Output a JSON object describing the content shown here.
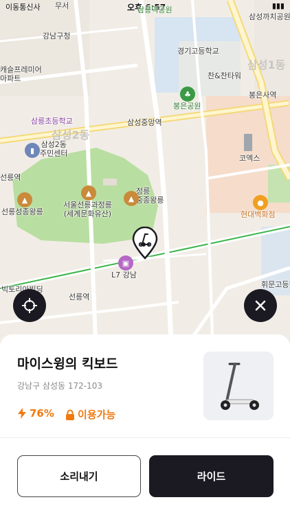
{
  "status_bar": {
    "time": "오후 6:57",
    "carrier": "이동통신사"
  },
  "map": {
    "labels": {
      "gangnam_office": "강남구청",
      "castle_apt": "캐슬프레미어\n아파트",
      "gyeonggi_school": "경기고등학교",
      "chan_tower": "찬&찬타워",
      "samseong1": "삼성1동",
      "bongeunsa_stn": "봉은사역",
      "bongeun_park": "봉은공원",
      "samneung_elem": "삼릉초등학교",
      "samseong_jungang": "삼성중앙역",
      "samseong2": "삼성2동",
      "samseong2_center": "삼성2동\n주민센터",
      "coex": "코엑스",
      "seolleung_stn_left": "선릉역",
      "seolleung_tomb": "서울선릉과정릉\n(세계문화유산)",
      "jeongneung": "정릉\n중종왕릉",
      "seongjong": "선릉성종왕릉",
      "hyundai": "현대백화점",
      "l7": "L7 강남",
      "victory": "빅토리아빌딩",
      "seolleung_stn": "선릉역",
      "hwimun": "휘문고등학교",
      "samsung_magpie": "삼성까치공원",
      "samneung_park": "삼릉역공원",
      "top_left_road": "무서"
    }
  },
  "scooter": {
    "name": "마이스윙의 킥보드",
    "address": "강남구 삼성동 172-103",
    "battery": "76%",
    "availability": "이용가능"
  },
  "buttons": {
    "sound": "소리내기",
    "ride": "라이드"
  },
  "colors": {
    "accent": "#f07a10",
    "dark": "#1b1a22",
    "park": "#b9dea1",
    "metro_green": "#3cb44a"
  }
}
